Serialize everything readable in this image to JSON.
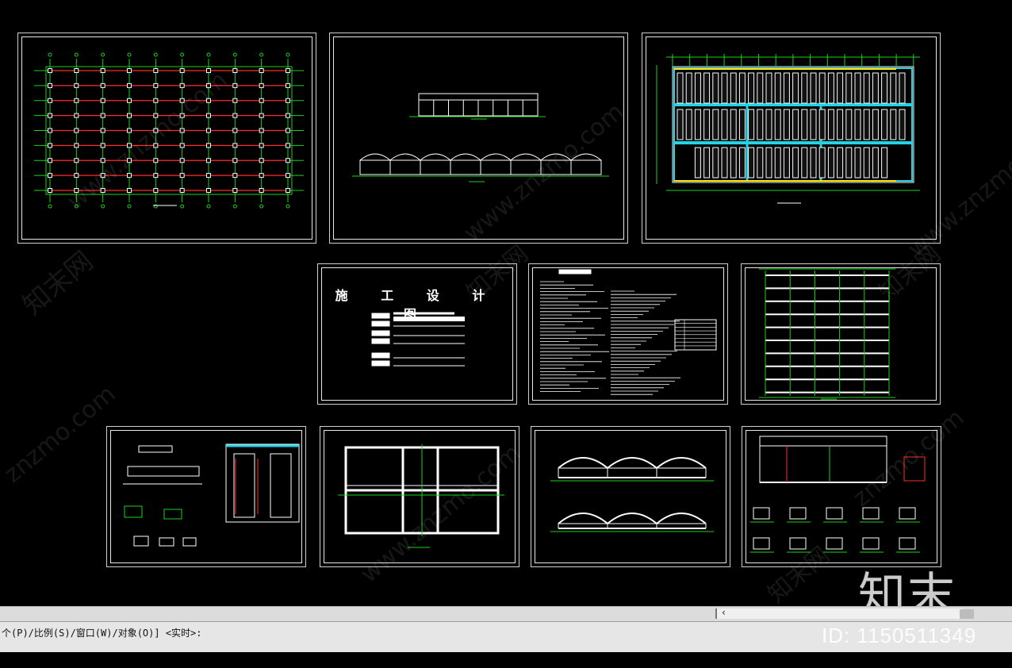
{
  "sheets": {
    "cover_title": "施 工 设 计 图"
  },
  "command_line": {
    "prompt": "个(P)/比例(S)/窗口(W)/对象(O)] <实时>:"
  },
  "watermark": {
    "url": "www.znzmo.com",
    "url_short": "znzmo.com",
    "brand_small": "知末网",
    "brand_large": "知末",
    "id": "ID: 1150511349"
  },
  "colors": {
    "background": "#000000",
    "grid_red": "#ff2a2a",
    "grid_green": "#19d219",
    "column_white": "#ffffff",
    "accent_cyan": "#22d3e6",
    "accent_yellow": "#ffe600"
  },
  "icons": {
    "scroll_left": "‹"
  }
}
